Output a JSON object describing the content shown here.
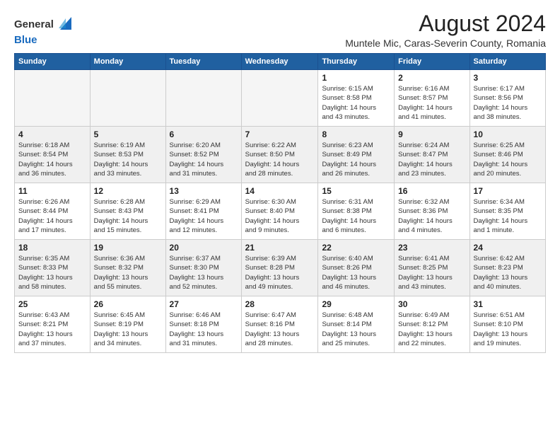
{
  "header": {
    "logo_general": "General",
    "logo_blue": "Blue",
    "month_title": "August 2024",
    "location": "Muntele Mic, Caras-Severin County, Romania"
  },
  "days_of_week": [
    "Sunday",
    "Monday",
    "Tuesday",
    "Wednesday",
    "Thursday",
    "Friday",
    "Saturday"
  ],
  "weeks": [
    {
      "shaded": false,
      "days": [
        {
          "num": "",
          "info": ""
        },
        {
          "num": "",
          "info": ""
        },
        {
          "num": "",
          "info": ""
        },
        {
          "num": "",
          "info": ""
        },
        {
          "num": "1",
          "info": "Sunrise: 6:15 AM\nSunset: 8:58 PM\nDaylight: 14 hours\nand 43 minutes."
        },
        {
          "num": "2",
          "info": "Sunrise: 6:16 AM\nSunset: 8:57 PM\nDaylight: 14 hours\nand 41 minutes."
        },
        {
          "num": "3",
          "info": "Sunrise: 6:17 AM\nSunset: 8:56 PM\nDaylight: 14 hours\nand 38 minutes."
        }
      ]
    },
    {
      "shaded": true,
      "days": [
        {
          "num": "4",
          "info": "Sunrise: 6:18 AM\nSunset: 8:54 PM\nDaylight: 14 hours\nand 36 minutes."
        },
        {
          "num": "5",
          "info": "Sunrise: 6:19 AM\nSunset: 8:53 PM\nDaylight: 14 hours\nand 33 minutes."
        },
        {
          "num": "6",
          "info": "Sunrise: 6:20 AM\nSunset: 8:52 PM\nDaylight: 14 hours\nand 31 minutes."
        },
        {
          "num": "7",
          "info": "Sunrise: 6:22 AM\nSunset: 8:50 PM\nDaylight: 14 hours\nand 28 minutes."
        },
        {
          "num": "8",
          "info": "Sunrise: 6:23 AM\nSunset: 8:49 PM\nDaylight: 14 hours\nand 26 minutes."
        },
        {
          "num": "9",
          "info": "Sunrise: 6:24 AM\nSunset: 8:47 PM\nDaylight: 14 hours\nand 23 minutes."
        },
        {
          "num": "10",
          "info": "Sunrise: 6:25 AM\nSunset: 8:46 PM\nDaylight: 14 hours\nand 20 minutes."
        }
      ]
    },
    {
      "shaded": false,
      "days": [
        {
          "num": "11",
          "info": "Sunrise: 6:26 AM\nSunset: 8:44 PM\nDaylight: 14 hours\nand 17 minutes."
        },
        {
          "num": "12",
          "info": "Sunrise: 6:28 AM\nSunset: 8:43 PM\nDaylight: 14 hours\nand 15 minutes."
        },
        {
          "num": "13",
          "info": "Sunrise: 6:29 AM\nSunset: 8:41 PM\nDaylight: 14 hours\nand 12 minutes."
        },
        {
          "num": "14",
          "info": "Sunrise: 6:30 AM\nSunset: 8:40 PM\nDaylight: 14 hours\nand 9 minutes."
        },
        {
          "num": "15",
          "info": "Sunrise: 6:31 AM\nSunset: 8:38 PM\nDaylight: 14 hours\nand 6 minutes."
        },
        {
          "num": "16",
          "info": "Sunrise: 6:32 AM\nSunset: 8:36 PM\nDaylight: 14 hours\nand 4 minutes."
        },
        {
          "num": "17",
          "info": "Sunrise: 6:34 AM\nSunset: 8:35 PM\nDaylight: 14 hours\nand 1 minute."
        }
      ]
    },
    {
      "shaded": true,
      "days": [
        {
          "num": "18",
          "info": "Sunrise: 6:35 AM\nSunset: 8:33 PM\nDaylight: 13 hours\nand 58 minutes."
        },
        {
          "num": "19",
          "info": "Sunrise: 6:36 AM\nSunset: 8:32 PM\nDaylight: 13 hours\nand 55 minutes."
        },
        {
          "num": "20",
          "info": "Sunrise: 6:37 AM\nSunset: 8:30 PM\nDaylight: 13 hours\nand 52 minutes."
        },
        {
          "num": "21",
          "info": "Sunrise: 6:39 AM\nSunset: 8:28 PM\nDaylight: 13 hours\nand 49 minutes."
        },
        {
          "num": "22",
          "info": "Sunrise: 6:40 AM\nSunset: 8:26 PM\nDaylight: 13 hours\nand 46 minutes."
        },
        {
          "num": "23",
          "info": "Sunrise: 6:41 AM\nSunset: 8:25 PM\nDaylight: 13 hours\nand 43 minutes."
        },
        {
          "num": "24",
          "info": "Sunrise: 6:42 AM\nSunset: 8:23 PM\nDaylight: 13 hours\nand 40 minutes."
        }
      ]
    },
    {
      "shaded": false,
      "days": [
        {
          "num": "25",
          "info": "Sunrise: 6:43 AM\nSunset: 8:21 PM\nDaylight: 13 hours\nand 37 minutes."
        },
        {
          "num": "26",
          "info": "Sunrise: 6:45 AM\nSunset: 8:19 PM\nDaylight: 13 hours\nand 34 minutes."
        },
        {
          "num": "27",
          "info": "Sunrise: 6:46 AM\nSunset: 8:18 PM\nDaylight: 13 hours\nand 31 minutes."
        },
        {
          "num": "28",
          "info": "Sunrise: 6:47 AM\nSunset: 8:16 PM\nDaylight: 13 hours\nand 28 minutes."
        },
        {
          "num": "29",
          "info": "Sunrise: 6:48 AM\nSunset: 8:14 PM\nDaylight: 13 hours\nand 25 minutes."
        },
        {
          "num": "30",
          "info": "Sunrise: 6:49 AM\nSunset: 8:12 PM\nDaylight: 13 hours\nand 22 minutes."
        },
        {
          "num": "31",
          "info": "Sunrise: 6:51 AM\nSunset: 8:10 PM\nDaylight: 13 hours\nand 19 minutes."
        }
      ]
    }
  ]
}
